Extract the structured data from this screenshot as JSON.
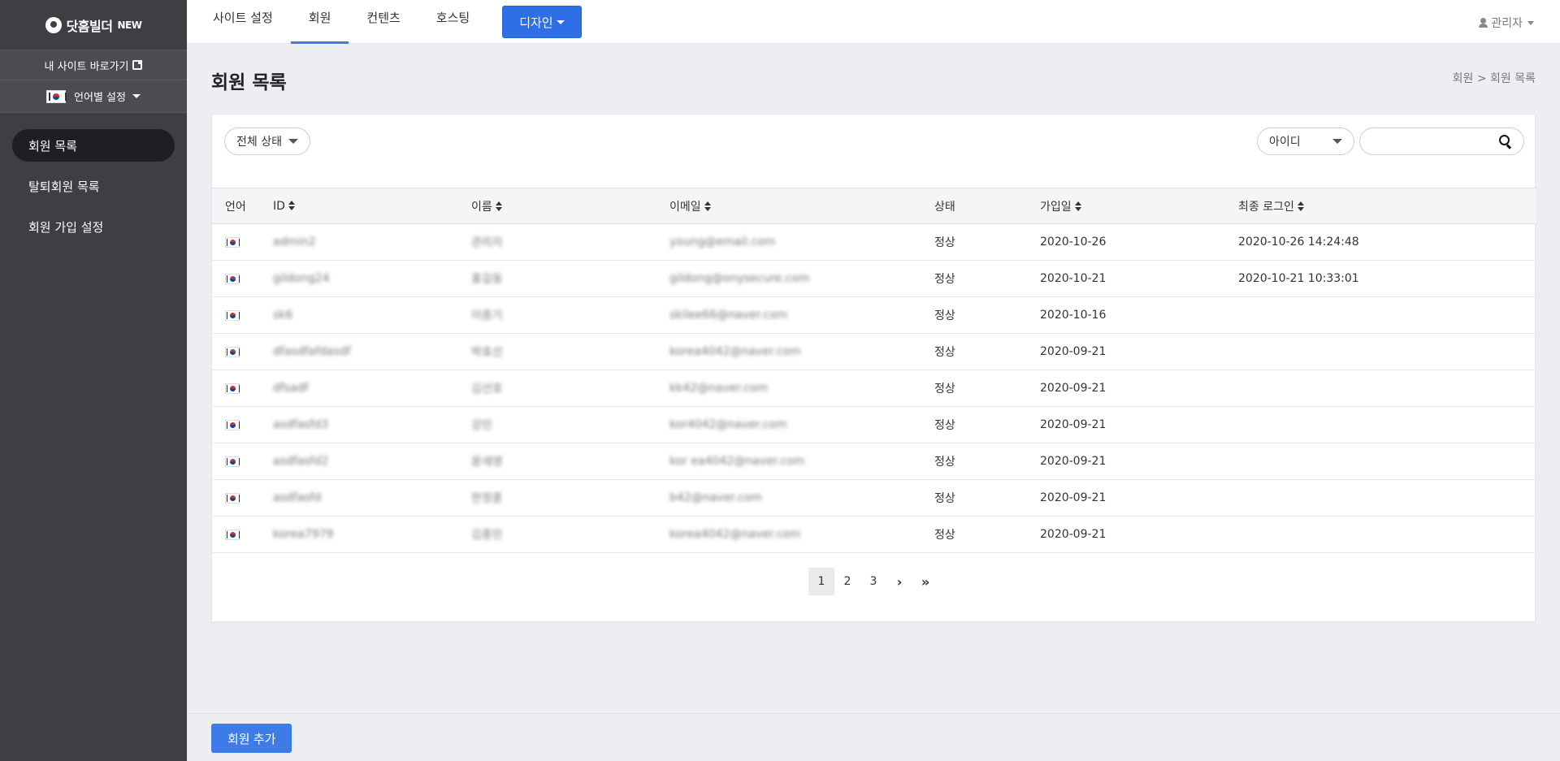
{
  "sidebar": {
    "brand": "닷홈빌더",
    "brand_badge": "NEW",
    "site_link": "내 사이트 바로가기",
    "language": "언어별 설정",
    "items": [
      {
        "label": "회원 목록"
      },
      {
        "label": "탈퇴회원 목록"
      },
      {
        "label": "회원 가입 설정"
      }
    ]
  },
  "topnav": {
    "tabs": [
      {
        "label": "사이트 설정"
      },
      {
        "label": "회원"
      },
      {
        "label": "컨텐츠"
      },
      {
        "label": "호스팅"
      }
    ],
    "design": "디자인",
    "admin": "관리자"
  },
  "page": {
    "title": "회원 목록",
    "breadcrumb": "회원 > 회원 목록"
  },
  "filters": {
    "status": "전체 상태",
    "field": "아이디",
    "search_value": ""
  },
  "table": {
    "headers": {
      "lang": "언어",
      "id": "ID",
      "name": "이름",
      "email": "이메일",
      "status": "상태",
      "joined": "가입일",
      "last_login": "최종 로그인"
    },
    "rows": [
      {
        "id": "admin2",
        "name": "관리자",
        "email": "young@email.com",
        "status": "정상",
        "joined": "2020-10-26",
        "last_login": "2020-10-26 14:24:48"
      },
      {
        "id": "gildong24",
        "name": "홍길동",
        "email": "gildong@onysecure.com",
        "status": "정상",
        "joined": "2020-10-21",
        "last_login": "2020-10-21 10:33:01"
      },
      {
        "id": "sk6",
        "name": "이종기",
        "email": "skilee66@naver.com",
        "status": "정상",
        "joined": "2020-10-16",
        "last_login": ""
      },
      {
        "id": "dfasdfafdasdf",
        "name": "박효선",
        "email": "korea4042@naver.com",
        "status": "정상",
        "joined": "2020-09-21",
        "last_login": ""
      },
      {
        "id": "dfsadf",
        "name": "김선호",
        "email": "kk42@naver.com",
        "status": "정상",
        "joined": "2020-09-21",
        "last_login": ""
      },
      {
        "id": "asdfasfd3",
        "name": "강민",
        "email": "kor4042@naver.com",
        "status": "정상",
        "joined": "2020-09-21",
        "last_login": ""
      },
      {
        "id": "asdfasfd2",
        "name": "윤세영",
        "email": "kor ea4042@naver.com",
        "status": "정상",
        "joined": "2020-09-21",
        "last_login": ""
      },
      {
        "id": "asdfasfd",
        "name": "한정훈",
        "email": "b42@naver.com",
        "status": "정상",
        "joined": "2020-09-21",
        "last_login": ""
      },
      {
        "id": "korea7979",
        "name": "김종민",
        "email": "korea4042@naver.com",
        "status": "정상",
        "joined": "2020-09-21",
        "last_login": ""
      }
    ]
  },
  "pagination": {
    "pages": [
      "1",
      "2",
      "3"
    ],
    "next": "›",
    "last": "»"
  },
  "footer": {
    "add_label": "회원 추가"
  },
  "colors": {
    "sidebar_bg": "#3d3f43",
    "accent": "#3d7ce6",
    "design_button": "#2f6fe6"
  }
}
